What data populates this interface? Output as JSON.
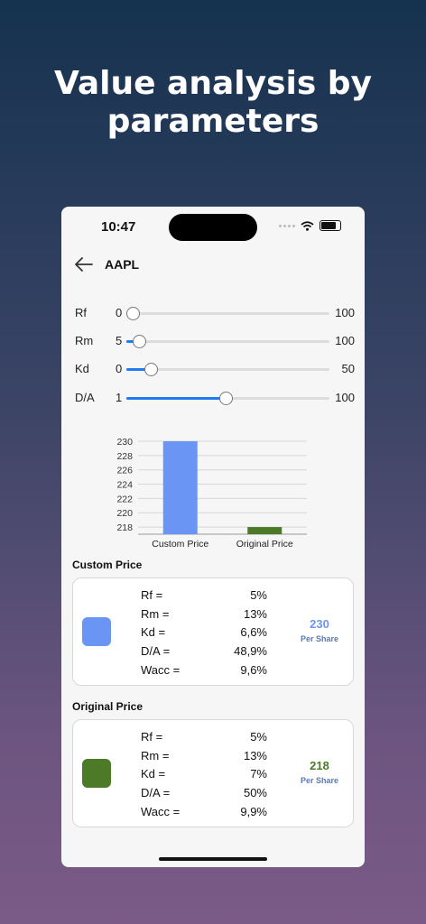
{
  "headline": {
    "line1": "Value analysis by",
    "line2": "parameters"
  },
  "status": {
    "time": "10:47"
  },
  "nav": {
    "title": "AAPL",
    "back_icon": "arrow-left-icon"
  },
  "sliders": [
    {
      "label": "Rf",
      "min": "0",
      "max": "100",
      "fraction": 0.03
    },
    {
      "label": "Rm",
      "min": "5",
      "max": "100",
      "fraction": 0.06
    },
    {
      "label": "Kd",
      "min": "0",
      "max": "50",
      "fraction": 0.12
    },
    {
      "label": "D/A",
      "min": "1",
      "max": "100",
      "fraction": 0.49
    }
  ],
  "chart_data": {
    "type": "bar",
    "categories": [
      "Custom Price",
      "Original Price"
    ],
    "values": [
      230,
      218
    ],
    "colors": [
      "#6b95f5",
      "#4d7a27"
    ],
    "ylim": [
      217,
      230
    ],
    "yticks": [
      "218",
      "220",
      "222",
      "224",
      "226",
      "228",
      "230"
    ],
    "grid": true
  },
  "custom": {
    "title": "Custom Price",
    "color": "#6b95f5",
    "params": [
      {
        "k": "Rf =",
        "v": "5%"
      },
      {
        "k": "Rm =",
        "v": "13%"
      },
      {
        "k": "Kd =",
        "v": "6,6%"
      },
      {
        "k": "D/A =",
        "v": "48,9%"
      },
      {
        "k": "Wacc =",
        "v": "9,6%"
      }
    ],
    "value": "230",
    "per_share": "Per Share"
  },
  "original": {
    "title": "Original Price",
    "color": "#4d7a27",
    "params": [
      {
        "k": "Rf =",
        "v": "5%"
      },
      {
        "k": "Rm =",
        "v": "13%"
      },
      {
        "k": "Kd =",
        "v": "7%"
      },
      {
        "k": "D/A =",
        "v": "50%"
      },
      {
        "k": "Wacc =",
        "v": "9,9%"
      }
    ],
    "value": "218",
    "per_share": "Per Share"
  }
}
